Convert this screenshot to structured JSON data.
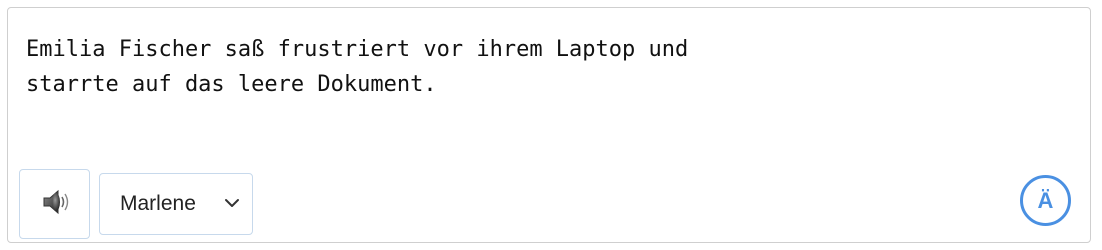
{
  "editor": {
    "text": "Emilia Fischer saß frustriert vor ihrem Laptop und\nstarrte auf das leere Dokument."
  },
  "toolbar": {
    "speaker_icon": "speaker-icon",
    "voice_selected": "Marlene",
    "voice_chevron_icon": "chevron-down-icon",
    "language_badge": "Ä"
  },
  "colors": {
    "accent": "#4a90e2",
    "border": "#cfcfcf",
    "control_border": "#c7d9ec"
  }
}
